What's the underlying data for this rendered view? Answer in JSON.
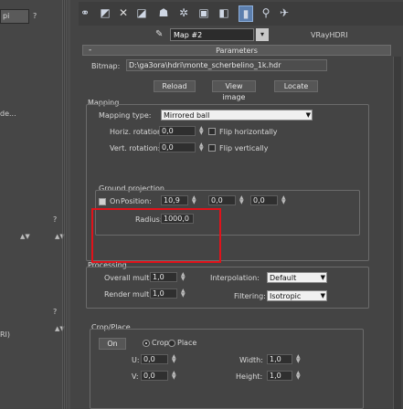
{
  "left_panel": {
    "items": [
      {
        "label": "pi",
        "top": 0
      },
      {
        "label": "?",
        "top": 0
      },
      {
        "label": "de...",
        "top": 0
      },
      {
        "label": "?",
        "top": 0
      },
      {
        "label": "?",
        "top": 0
      },
      {
        "label": "RI)",
        "top": 0
      }
    ]
  },
  "toolbar": {
    "icons": [
      "eye-icon",
      "material-icon",
      "delete-icon",
      "unique-icon",
      "map-icon",
      "settings-icon",
      "checker-icon",
      "bg-icon",
      "highlight-icon",
      "pick-icon",
      "bar-icon"
    ]
  },
  "map_row": {
    "name": "Map #2",
    "type": "VRayHDRI"
  },
  "parameters": {
    "rollout_title": "Parameters",
    "rollout_sign": "-",
    "bitmap_label": "Bitmap:",
    "bitmap_path": "D:\\ga3ora\\hdri\\monte_scherbelino_1k.hdr",
    "reload": "Reload",
    "view_image": "View image",
    "locate": "Locate",
    "mapping_label": "Mapping",
    "mapping_type_label": "Mapping type:",
    "mapping_type_value": "Mirrored ball",
    "horiz_rotation_label": "Horiz. rotation:",
    "horiz_rotation_value": "0,0",
    "flip_horizontally": "Flip horizontally",
    "vert_rotation_label": "Vert. rotation:",
    "vert_rotation_value": "0,0",
    "flip_vertically": "Flip vertically",
    "ground_projection": "Ground projection",
    "on_label": "On",
    "position_label": "Position:",
    "position_x": "10,9",
    "position_y": "0,0",
    "position_z": "0,0",
    "radius_label": "Radius:",
    "radius_value": "1000,0"
  },
  "processing": {
    "label": "Processing",
    "overall_mult_label": "Overall mult:",
    "overall_mult_value": "1,0",
    "render_mult_label": "Render mult:",
    "render_mult_value": "1,0",
    "interpolation_label": "Interpolation:",
    "interpolation_value": "Default",
    "filtering_label": "Filtering:",
    "filtering_value": "Isotropic"
  },
  "crop": {
    "label": "Crop/Place",
    "on_label": "On",
    "crop_label": "Crop",
    "place_label": "Place",
    "u_label": "U:",
    "u_value": "0,0",
    "v_label": "V:",
    "v_value": "0,0",
    "width_label": "Width:",
    "width_value": "1,0",
    "height_label": "Height:",
    "height_value": "1,0"
  }
}
